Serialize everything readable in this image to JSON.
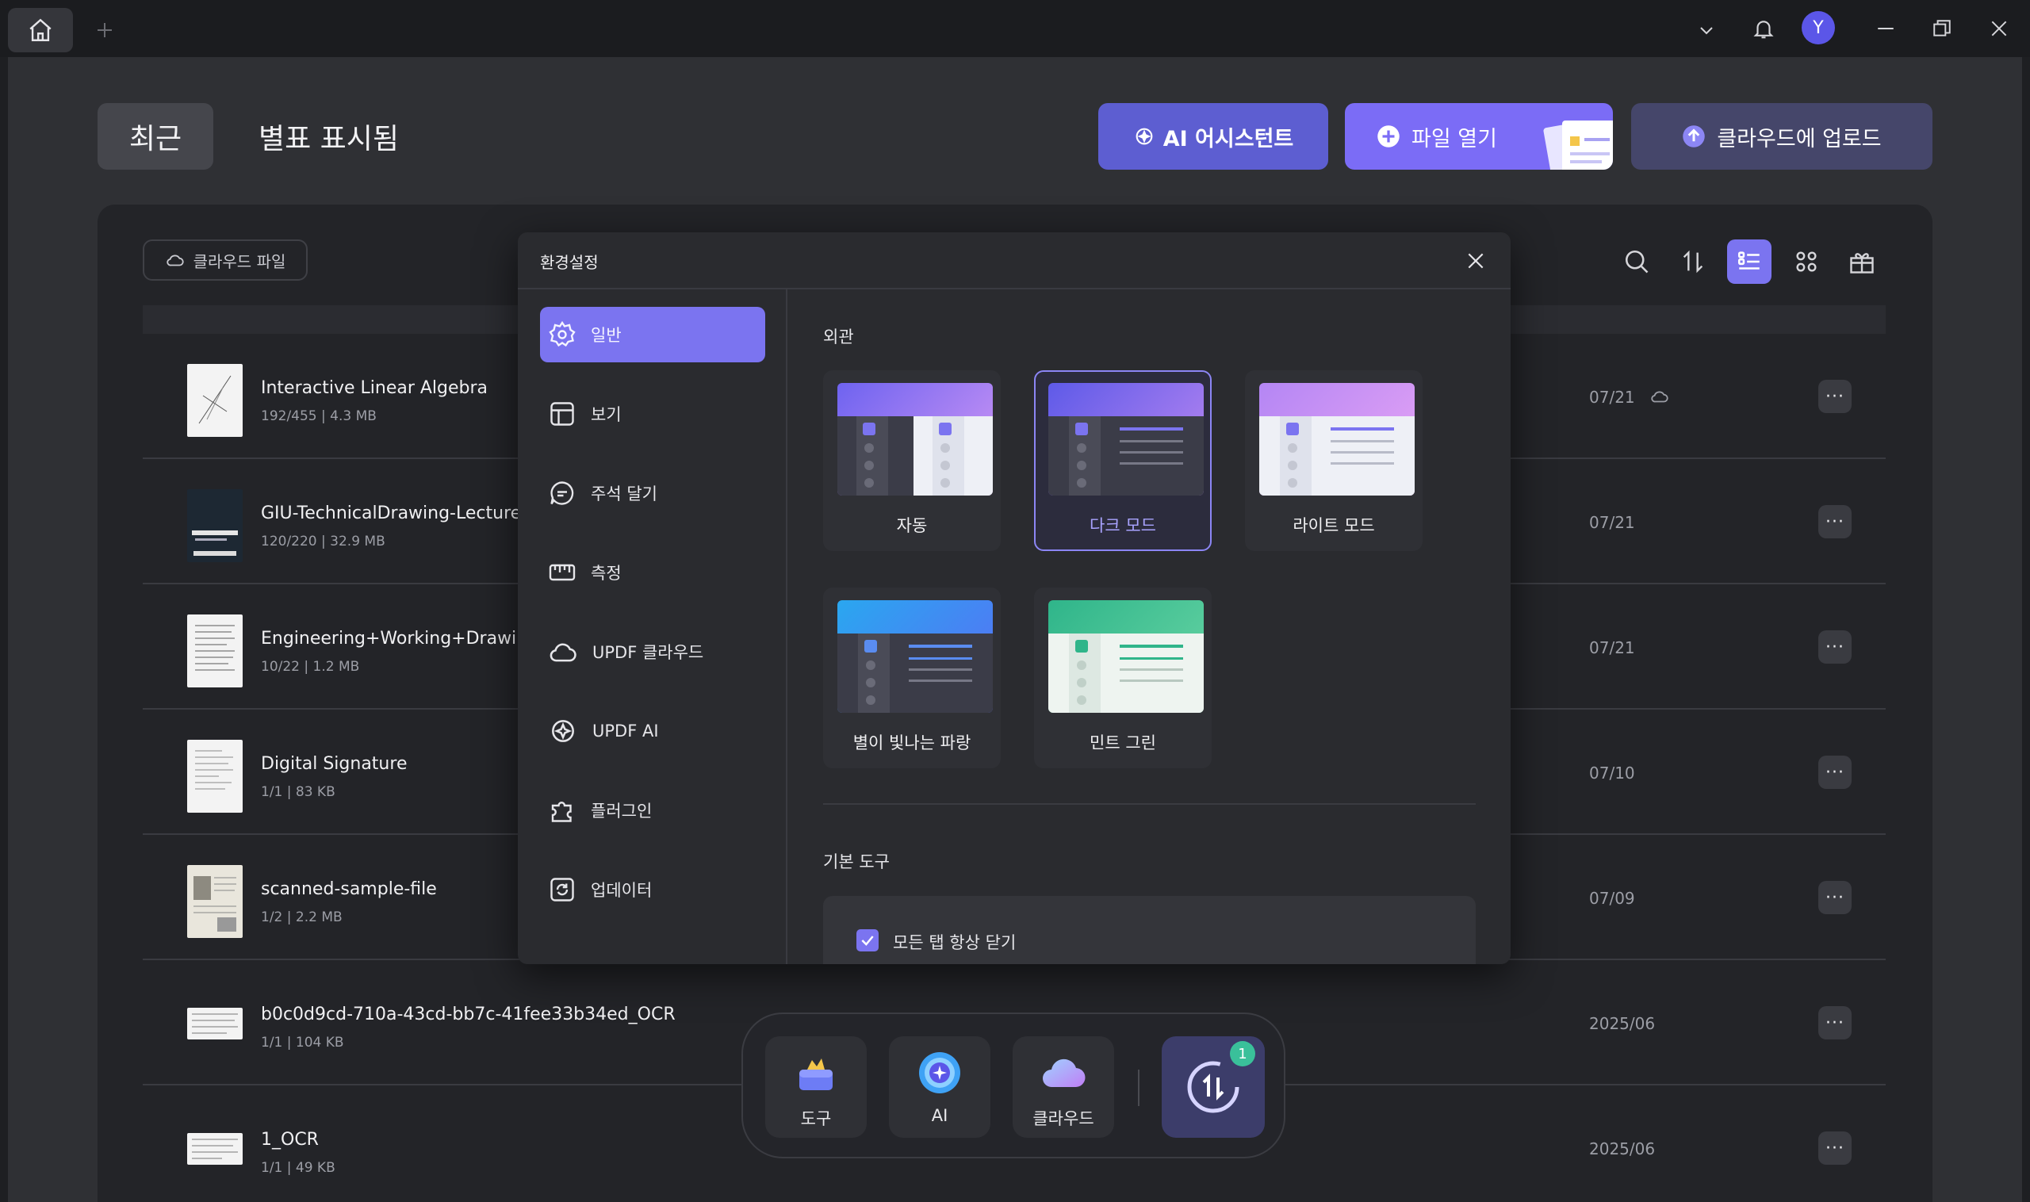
{
  "titlebar": {
    "avatar_letter": "Y",
    "icons": [
      "home-icon",
      "plus-icon",
      "chevron-down-icon",
      "bell-icon",
      "minimize-icon",
      "restore-icon",
      "close-icon"
    ]
  },
  "header": {
    "tab_recent": "최근",
    "tab_starred": "별표 표시됨",
    "ai_button": "AI 어시스턴트",
    "open_file_button": "파일 열기",
    "upload_button": "클라우드에 업로드"
  },
  "toolbar": {
    "cloud_files": "클라우드 파일",
    "icons": [
      "search-icon",
      "sort-icon",
      "list-view-icon",
      "grid-view-icon",
      "gift-icon"
    ]
  },
  "files": [
    {
      "name": "Interactive Linear Algebra",
      "meta": "192/455 | 4.3 MB",
      "date": "07/21",
      "cloud": true
    },
    {
      "name": "GIU-TechnicalDrawing-LectureNotes",
      "meta": "120/220 | 32.9 MB",
      "date": "07/21"
    },
    {
      "name": "Engineering+Working+Drawing+Basics",
      "meta": "10/22 | 1.2 MB",
      "date": "07/21"
    },
    {
      "name": "Digital Signature",
      "meta": "1/1 | 83 KB",
      "date": "07/10"
    },
    {
      "name": "scanned-sample-file",
      "meta": "1/2 | 2.2 MB",
      "date": "07/09"
    },
    {
      "name": "b0c0d9cd-710a-43cd-bb7c-41fee33b34ed_OCR",
      "meta": "1/1 | 104 KB",
      "date": "2025/06"
    },
    {
      "name": "1_OCR",
      "meta": "1/1 | 49 KB",
      "date": "2025/06"
    }
  ],
  "more_label": "···",
  "settings": {
    "title": "환경설정",
    "nav": [
      {
        "label": "일반",
        "icon": "gear-icon",
        "active": true
      },
      {
        "label": "보기",
        "icon": "layout-icon"
      },
      {
        "label": "주석 달기",
        "icon": "comment-icon"
      },
      {
        "label": "측정",
        "icon": "ruler-icon"
      },
      {
        "label": "UPDF 클라우드",
        "icon": "cloud-icon"
      },
      {
        "label": "UPDF AI",
        "icon": "ai-icon"
      },
      {
        "label": "플러그인",
        "icon": "plugin-icon"
      },
      {
        "label": "업데이터",
        "icon": "update-icon"
      }
    ],
    "appearance_label": "외관",
    "themes": [
      {
        "label": "자동"
      },
      {
        "label": "다크 모드",
        "selected": true
      },
      {
        "label": "라이트 모드"
      },
      {
        "label": "별이 빛나는 파랑"
      },
      {
        "label": "민트 그린"
      }
    ],
    "basic_tools_label": "기본 도구",
    "option_close_all_tabs": "모든 탭 항상 닫기",
    "option_checked": true
  },
  "dock": {
    "tools": "도구",
    "ai": "AI",
    "cloud": "클라우드",
    "convert_badge": "1"
  },
  "colors": {
    "accent": "#7b74f0",
    "background": "#1e1f22",
    "panel": "#232428"
  }
}
